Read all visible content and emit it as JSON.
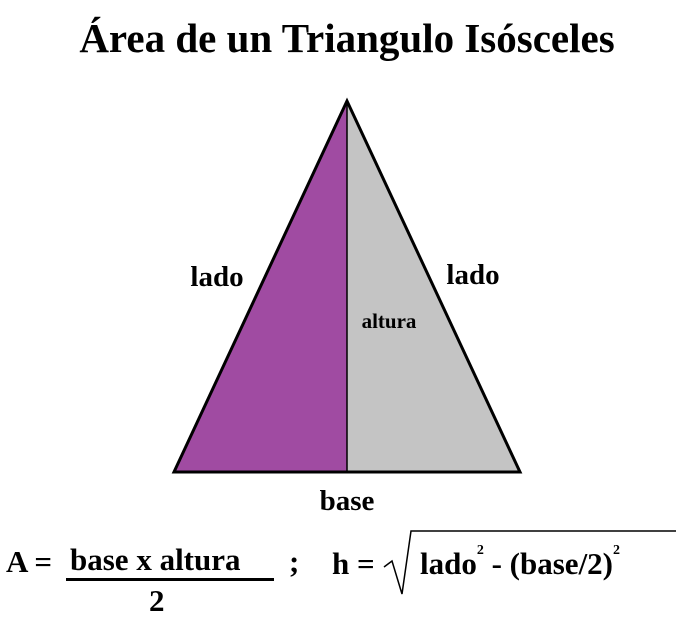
{
  "title": "Área de un Triangulo Isósceles",
  "colors": {
    "left_half": "#a04ba2",
    "right_half": "#c4c4c4",
    "outline": "#000000"
  },
  "triangle": {
    "left_side_label": "lado",
    "right_side_label": "lado",
    "height_label": "altura",
    "base_label": "base"
  },
  "formula_area": {
    "lhs": "A =",
    "numerator": "base x altura",
    "denominator": "2",
    "separator": ";"
  },
  "formula_height": {
    "lhs": "h =",
    "term1": "lado",
    "exp1": "2",
    "term2": "- (base/2)",
    "exp2": "2"
  }
}
